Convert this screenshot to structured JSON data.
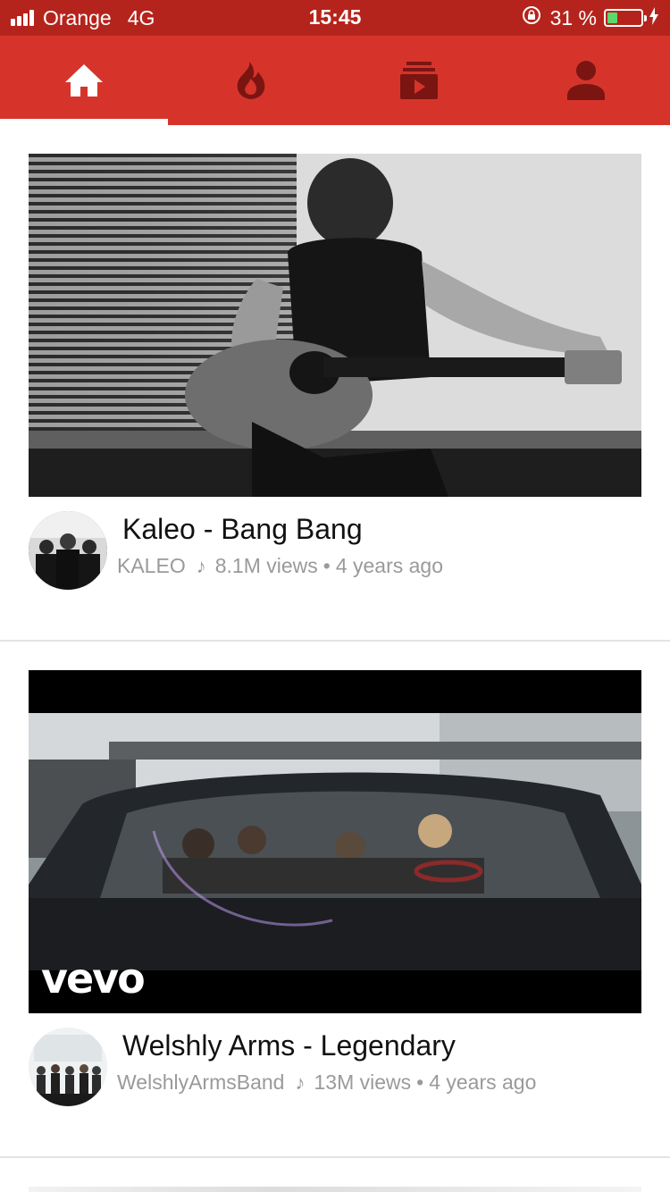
{
  "status_bar": {
    "carrier": "Orange",
    "network": "4G",
    "time": "15:45",
    "battery_percent": "31 %",
    "battery_level": 0.31,
    "background_color": "#b5241c"
  },
  "tabs": [
    {
      "icon": "home-icon",
      "active": true
    },
    {
      "icon": "flame-icon",
      "active": false
    },
    {
      "icon": "subscriptions-icon",
      "active": false
    },
    {
      "icon": "account-icon",
      "active": false
    }
  ],
  "accent_color": "#d6342b",
  "videos": [
    {
      "title": "Kaleo - Bang Bang",
      "channel": "KALEO",
      "views": "8.1M views",
      "age": "4 years ago"
    },
    {
      "title": "Welshly Arms - Legendary",
      "channel": "WelshlyArmsBand",
      "views": "13M views",
      "age": "4 years ago",
      "overlay_logo": "vevo"
    }
  ]
}
